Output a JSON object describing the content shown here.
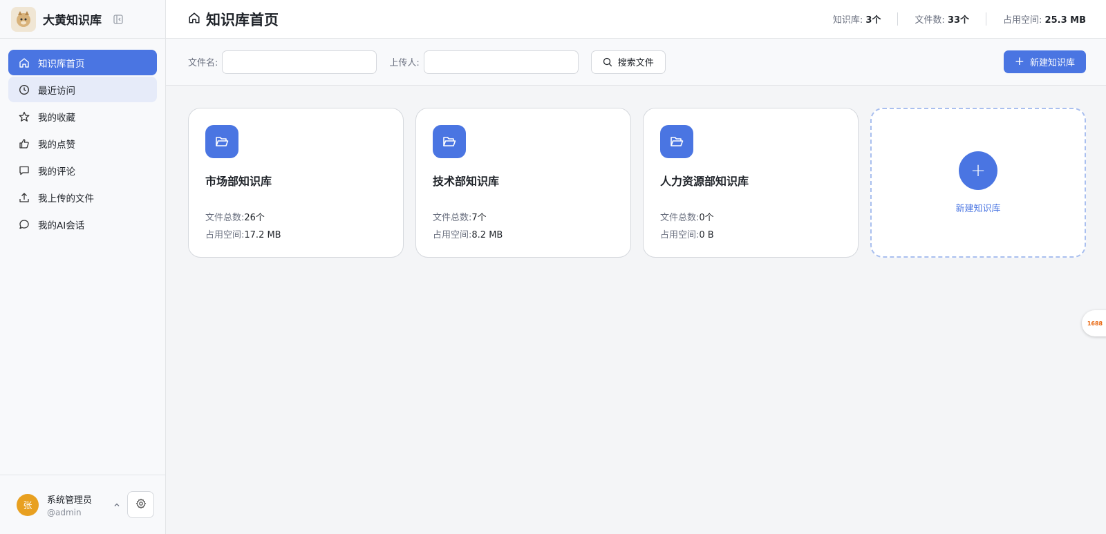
{
  "app": {
    "name": "大黄知识库"
  },
  "sidebar": {
    "items": [
      {
        "label": "知识库首页",
        "icon": "home-icon"
      },
      {
        "label": "最近访问",
        "icon": "clock-icon"
      },
      {
        "label": "我的收藏",
        "icon": "star-icon"
      },
      {
        "label": "我的点赞",
        "icon": "thumbs-up-icon"
      },
      {
        "label": "我的评论",
        "icon": "comment-icon"
      },
      {
        "label": "我上传的文件",
        "icon": "upload-icon"
      },
      {
        "label": "我的AI会话",
        "icon": "chat-icon"
      }
    ],
    "user": {
      "avatar_text": "张",
      "name": "系统管理员",
      "handle": "@admin"
    }
  },
  "header": {
    "title": "知识库首页",
    "stats": [
      {
        "label": "知识库: ",
        "value": "3个"
      },
      {
        "label": "文件数: ",
        "value": "33个"
      },
      {
        "label": "占用空间: ",
        "value": "25.3 MB"
      }
    ]
  },
  "toolbar": {
    "filename_label": "文件名:",
    "filename_value": "",
    "uploader_label": "上传人:",
    "uploader_value": "",
    "search_label": "搜索文件",
    "new_label": "新建知识库"
  },
  "cards": [
    {
      "title": "市场部知识库",
      "files_label": "文件总数:",
      "files": "26个",
      "size_label": "占用空间:",
      "size": "17.2 MB"
    },
    {
      "title": "技术部知识库",
      "files_label": "文件总数:",
      "files": "7个",
      "size_label": "占用空间:",
      "size": "8.2 MB"
    },
    {
      "title": "人力资源部知识库",
      "files_label": "文件总数:",
      "files": "0个",
      "size_label": "占用空间:",
      "size": "0 B"
    }
  ],
  "add_card": {
    "plus": "+",
    "label": "新建知识库"
  },
  "widget": {
    "text": "1688"
  },
  "colors": {
    "accent": "#4a75e2",
    "avatar": "#e8a020",
    "widget": "#e8650d"
  }
}
